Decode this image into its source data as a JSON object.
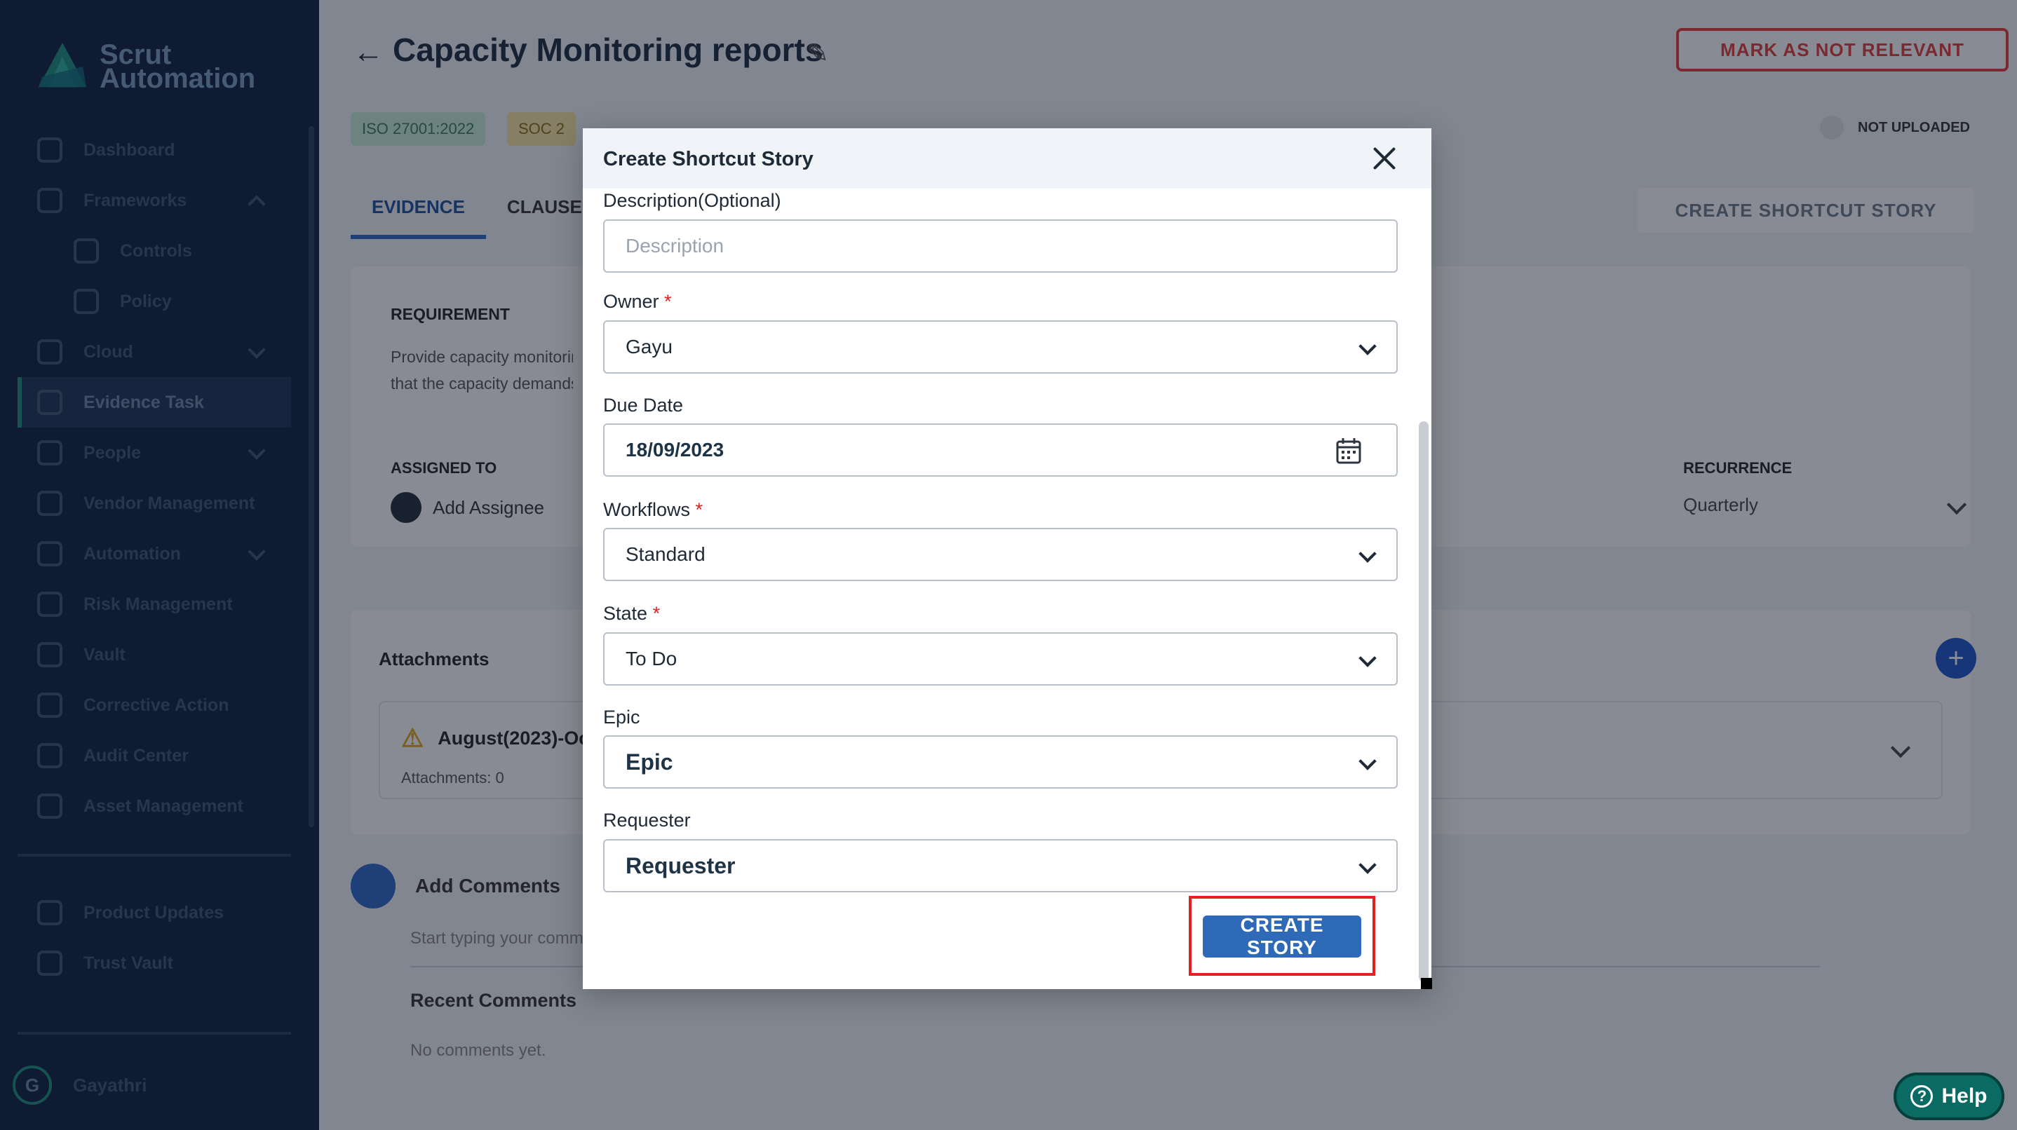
{
  "sidebar": {
    "logo_line1": "Scrut",
    "logo_line2": "Automation",
    "items": [
      {
        "label": "Dashboard"
      },
      {
        "label": "Frameworks"
      },
      {
        "label": "Controls"
      },
      {
        "label": "Policy"
      },
      {
        "label": "Cloud"
      },
      {
        "label": "Evidence Task"
      },
      {
        "label": "People"
      },
      {
        "label": "Vendor Management"
      },
      {
        "label": "Automation"
      },
      {
        "label": "Risk Management"
      },
      {
        "label": "Vault"
      },
      {
        "label": "Corrective Action"
      },
      {
        "label": "Audit Center"
      },
      {
        "label": "Asset Management"
      }
    ],
    "bottom_items": [
      {
        "label": "Product Updates"
      },
      {
        "label": "Trust Vault"
      }
    ],
    "user": {
      "initial": "G",
      "name": "Gayathri"
    }
  },
  "page": {
    "title": "Capacity Monitoring reports",
    "mark_not_relevant": "MARK AS NOT RELEVANT",
    "tags": [
      "ISO 27001:2022",
      "SOC 2"
    ],
    "upload_status": "NOT UPLOADED",
    "tabs": [
      "EVIDENCE",
      "CLAUSES"
    ],
    "create_shortcut_story": "CREATE SHORTCUT STORY",
    "requirement_label": "REQUIREMENT",
    "requirement_text_1": "Provide capacity monitoring",
    "requirement_text_2": "that the capacity demands",
    "assigned_to_label": "ASSIGNED TO",
    "add_assignee": "Add Assignee",
    "recurrence_label": "RECURRENCE",
    "recurrence_value": "Quarterly",
    "attachments_label": "Attachments",
    "attachment_title": "August(2023)-Oc",
    "attachment_meta": "Attachments: 0",
    "add_comments": "Add Comments",
    "comment_placeholder": "Start typing your comment",
    "recent_comments": "Recent Comments",
    "no_comments": "No comments yet."
  },
  "modal": {
    "title": "Create Shortcut Story",
    "description_label": "Description(Optional)",
    "description_placeholder": "Description",
    "owner_label": "Owner",
    "owner_value": "Gayu",
    "due_date_label": "Due Date",
    "due_date_value": "18/09/2023",
    "workflows_label": "Workflows",
    "workflows_value": "Standard",
    "state_label": "State",
    "state_value": "To Do",
    "epic_label": "Epic",
    "epic_value": "Epic",
    "requester_label": "Requester",
    "requester_value": "Requester",
    "required_mark": "*",
    "create_button": "CREATE STORY"
  },
  "help": {
    "label": "Help"
  },
  "colors": {
    "sidebar_bg": "#0d1f3d",
    "primary_button": "#2e6ab7",
    "highlight_box": "#e32121",
    "help_bg": "#0a6b64"
  }
}
